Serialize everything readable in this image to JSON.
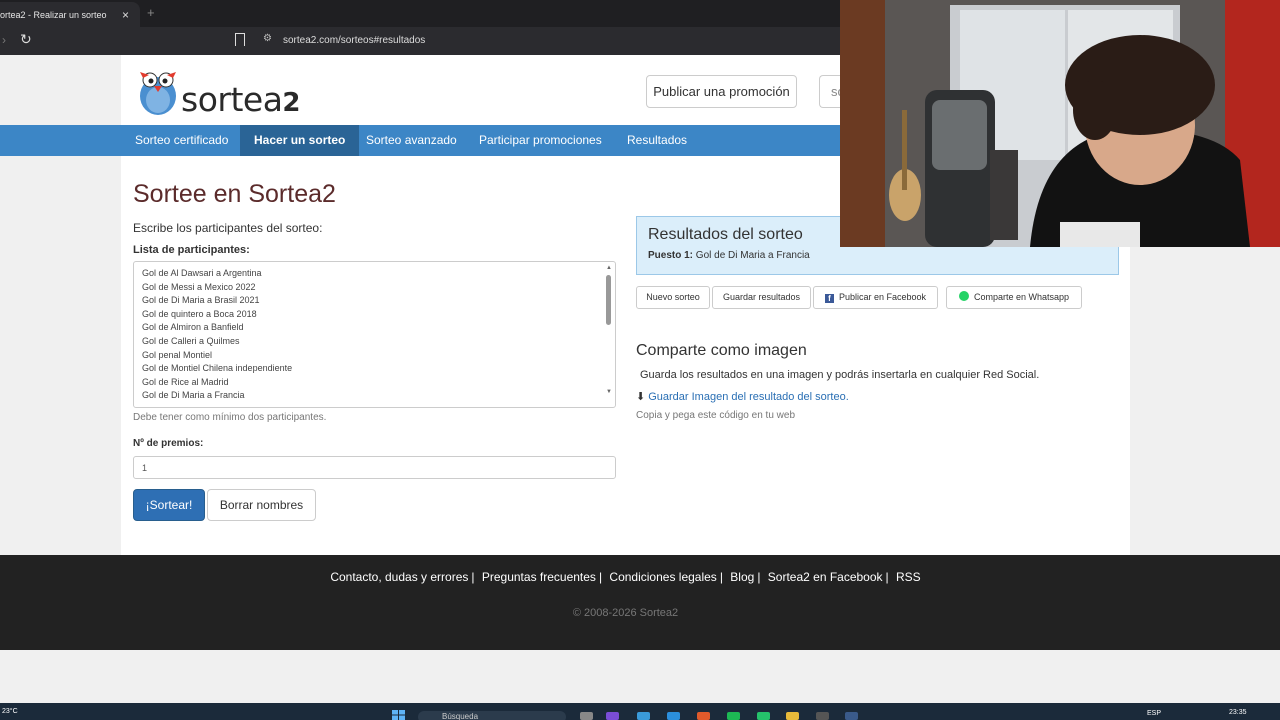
{
  "browser": {
    "tab_title": "orteа2 - Realizar un sorteo",
    "tab_close": "×",
    "new_tab": "+",
    "url": "sortea2.com/sorteos#resultados"
  },
  "header": {
    "logo_text": "sortea",
    "logo_suffix": "2",
    "publish_button": "Publicar una promoción",
    "partial_button": "so"
  },
  "nav": {
    "items": [
      {
        "label": "Sorteo certificado"
      },
      {
        "label": "Hacer un sorteo"
      },
      {
        "label": "Sorteo avanzado"
      },
      {
        "label": "Participar promociones"
      },
      {
        "label": "Resultados"
      }
    ],
    "active": "Hacer un sorteo"
  },
  "main": {
    "title": "Sortee en Sortea2",
    "subtitle": "Escribe los participantes del sorteo:",
    "list_label": "Lista de participantes:",
    "participants": [
      "Gol de Al Dawsari a Argentina",
      "Gol de Messi a Mexico 2022",
      "Gol de Di Maria a Brasil 2021",
      "Gol de quintero a Boca 2018",
      "Gol de Almiron a Banfield",
      "Gol de Calleri a Quilmes",
      "Gol penal Montiel",
      "Gol de Montiel Chilena independiente",
      "Gol de Rice al Madrid",
      "Gol de Di Maria a Francia"
    ],
    "hint": "Debe tener como mínimo dos participantes.",
    "prizes_label": "Nº de premios:",
    "prizes_value": "1",
    "draw_button": "¡Sortear!",
    "clear_button": "Borrar nombres"
  },
  "results": {
    "title": "Resultados del sorteo",
    "place_label": "Puesto 1:",
    "place_value": "Gol de Di Maria a Francia",
    "buttons": {
      "new": "Nuevo sorteo",
      "save": "Guardar resultados",
      "facebook": "Publicar en Facebook",
      "whatsapp": "Comparte en Whatsapp"
    }
  },
  "share": {
    "title": "Comparte como imagen",
    "description": "Guarda los resultados en una imagen y podrás insertarla en cualquier Red Social.",
    "download_link": "Guardar Imagen del resultado del sorteo.",
    "copy_code": "Copia y pega este código en tu web"
  },
  "footer": {
    "links": [
      "Contacto, dudas y errores",
      "Preguntas frecuentes",
      "Condiciones legales",
      "Blog",
      "Sortea2 en Facebook",
      "RSS"
    ],
    "separator": "|",
    "copyright": "© 2008-2026 Sortea2"
  },
  "taskbar": {
    "temperature": "23°C",
    "search_placeholder": "Búsqueda",
    "language": "ESP",
    "time": "23:35"
  },
  "colors": {
    "nav_bg": "#3c86c6",
    "nav_active": "#2a6496",
    "title": "#5b2b2b",
    "primary_button": "#2e6fb4",
    "results_bg": "#dbeefa",
    "footer_bg": "#222222"
  }
}
